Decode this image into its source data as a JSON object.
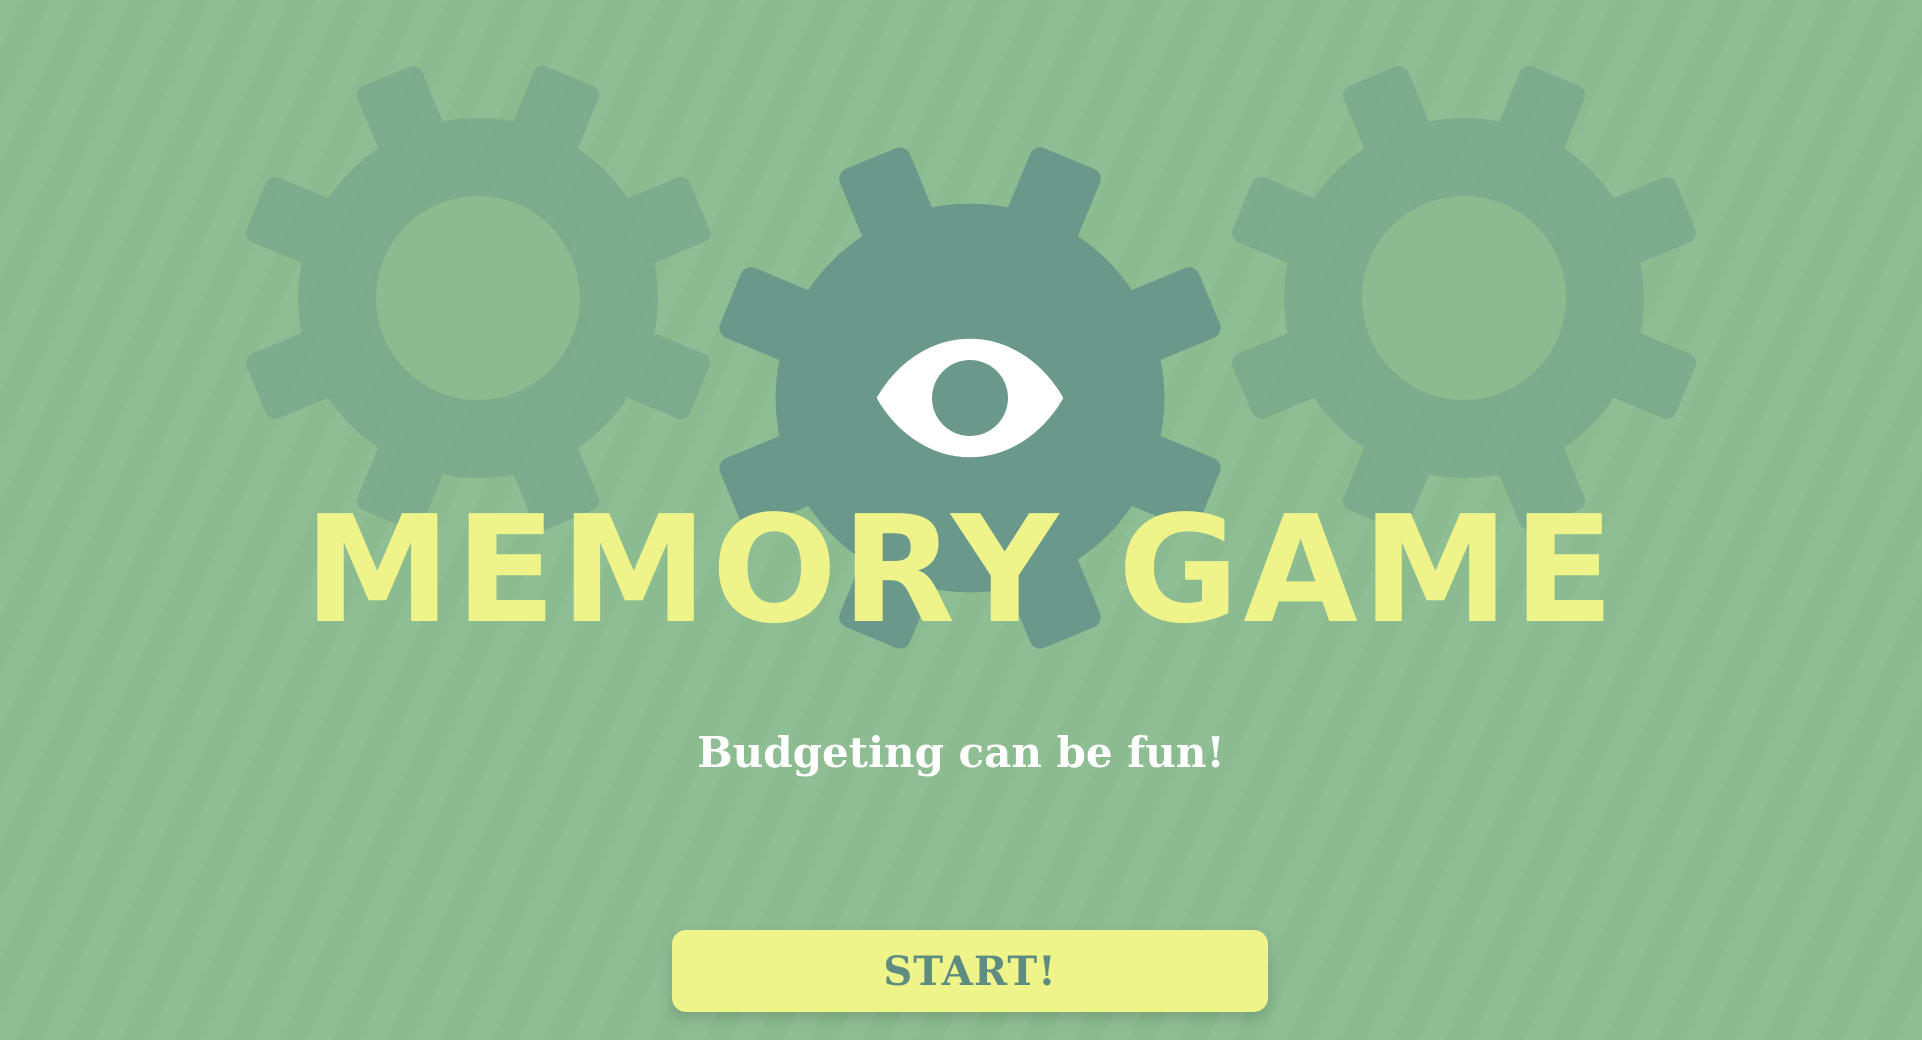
{
  "game": {
    "title": "MEMORY GAME",
    "subtitle": "Budgeting can be fun!",
    "start_label": "START!"
  },
  "icons": {
    "left_gear": "gear-icon",
    "center_gear": "gear-eye-icon",
    "right_gear": "gear-icon"
  },
  "colors": {
    "background": "#8bbb8f",
    "gear_faded": "#7aaa8c",
    "gear_center": "#6a998b",
    "title": "#eef48a",
    "button": "#eef48a",
    "button_text": "#5e8c80",
    "subtitle": "#ffffff"
  }
}
